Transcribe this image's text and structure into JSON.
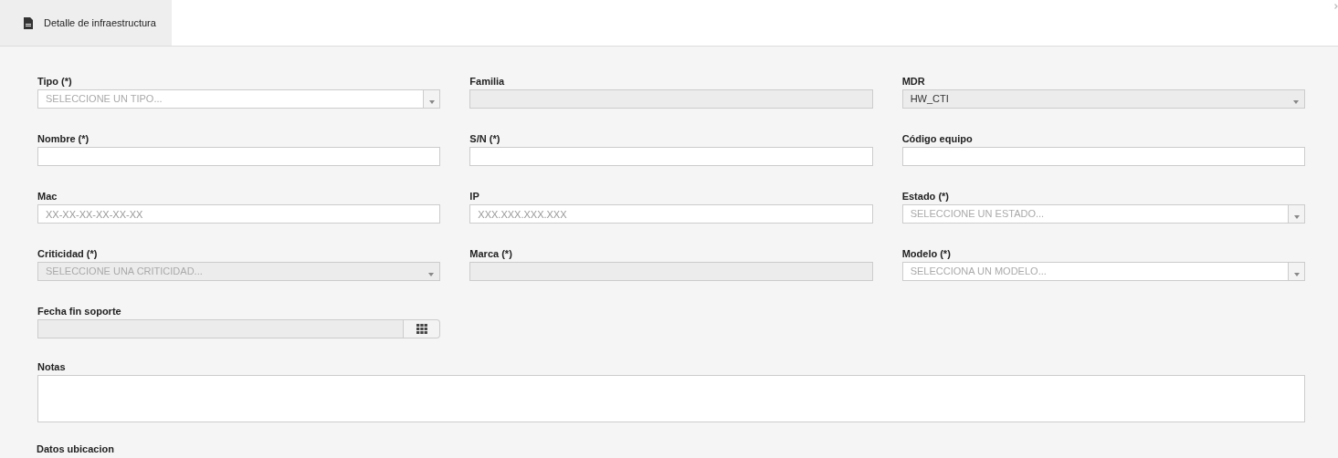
{
  "tabs": [
    {
      "label": "Detalle de infraestructura",
      "selected": true
    }
  ],
  "form_rows": [
    [
      {
        "label": "Tipo (*)",
        "kind": "select",
        "placeholder": "SELECCIONE UN TIPO...",
        "disabled": false
      },
      {
        "label": "Familia",
        "kind": "text",
        "disabled": true
      },
      {
        "label": "MDR",
        "kind": "select",
        "value": "HW_CTI",
        "disabled": true
      }
    ],
    [
      {
        "label": "Nombre (*)",
        "kind": "text",
        "disabled": false
      },
      {
        "label": "S/N (*)",
        "kind": "text",
        "disabled": false
      },
      {
        "label": "Código equipo",
        "kind": "text",
        "disabled": false
      }
    ],
    [
      {
        "label": "Mac",
        "kind": "text",
        "placeholder": "XX-XX-XX-XX-XX-XX",
        "disabled": false
      },
      {
        "label": "IP",
        "kind": "text",
        "placeholder": "XXX.XXX.XXX.XXX",
        "disabled": false
      },
      {
        "label": "Estado (*)",
        "kind": "select",
        "placeholder": "SELECCIONE UN ESTADO...",
        "disabled": false
      }
    ],
    [
      {
        "label": "Criticidad (*)",
        "kind": "select",
        "placeholder": "SELECCIONE UNA CRITICIDAD...",
        "disabled": true
      },
      {
        "label": "Marca (*)",
        "kind": "text",
        "disabled": true
      },
      {
        "label": "Modelo (*)",
        "kind": "select",
        "placeholder": "SELECCIONA UN MODELO...",
        "disabled": false
      }
    ],
    [
      {
        "label": "Fecha fin soporte",
        "kind": "date",
        "disabled": true
      }
    ]
  ],
  "notes": {
    "label": "Notas"
  },
  "section_title": "Datos ubicacion"
}
